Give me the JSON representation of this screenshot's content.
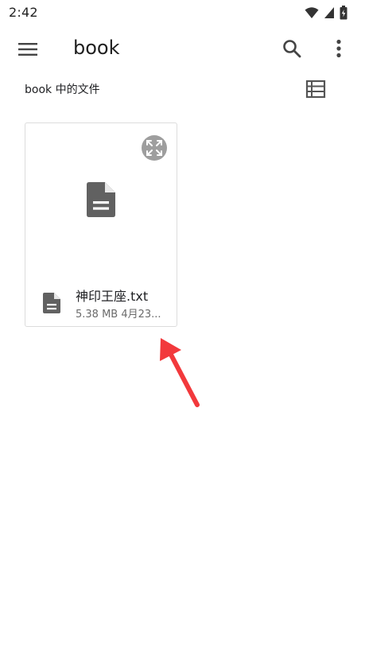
{
  "status_bar": {
    "time": "2:42"
  },
  "toolbar": {
    "title": "book"
  },
  "subheader": {
    "label": "book 中的文件"
  },
  "file_card": {
    "name": "神印王座.txt",
    "meta": "5.38 MB 4月23..."
  },
  "colors": {
    "icon": "#616161",
    "expand_bg": "#9e9e9e",
    "arrow": "#f2393c",
    "card_border": "#dcdcdc"
  },
  "icons": {
    "menu": "menu-icon",
    "search": "search-icon",
    "more": "more-vert-icon",
    "view_toggle": "list-view-icon",
    "expand": "expand-icon",
    "document": "document-icon"
  }
}
